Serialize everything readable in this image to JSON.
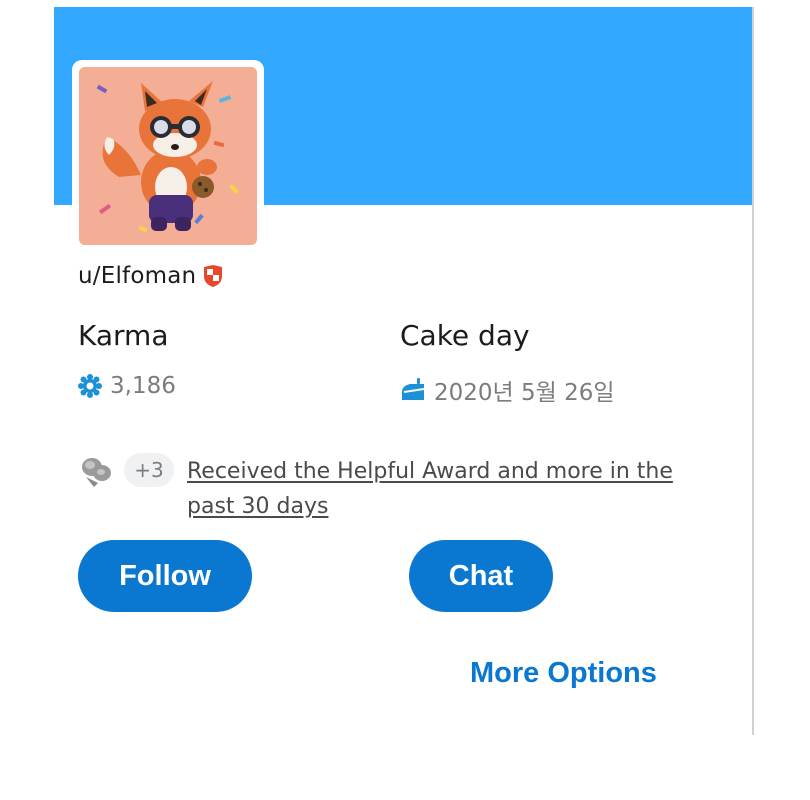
{
  "profile": {
    "username": "u/Elfoman",
    "banner_color": "#33a8ff",
    "avatar": "fox-avatar-illustration",
    "badge_icon": "shield-badge-icon"
  },
  "stats": {
    "karma": {
      "label": "Karma",
      "value": "3,186",
      "icon": "karma-flower-icon"
    },
    "cake_day": {
      "label": "Cake day",
      "value": "2020년 5월 26일",
      "icon": "cake-icon"
    }
  },
  "awards": {
    "icon": "trophy-award-icon",
    "count": "+3",
    "text": "Received the Helpful Award and more in the past 30 days"
  },
  "actions": {
    "follow": "Follow",
    "chat": "Chat",
    "more_options": "More Options"
  },
  "colors": {
    "accent": "#0a78d0",
    "karma_icon": "#1e90d8",
    "badge": "#e8472b"
  }
}
